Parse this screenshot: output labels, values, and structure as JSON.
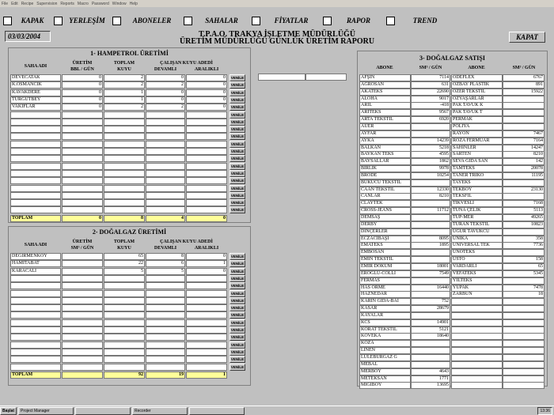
{
  "menu": [
    "File",
    "Edit",
    "Recipe",
    "Supervision",
    "Reports",
    "Macro",
    "Password",
    "Window",
    "Help"
  ],
  "nav": [
    "KAPAK",
    "YERLEŞİM",
    "ABONELER",
    "SAHALAR",
    "FİYATLAR",
    "RAPOR",
    "TREND"
  ],
  "date": "03/03/2004",
  "title1": "T.P.A.O. TRAKYA İŞLETME MÜDÜRLÜĞÜ",
  "title2": "ÜRETİM MÜDÜRLÜĞÜ GÜNLÜK ÜRETİM RAPORU",
  "close": "KAPAT",
  "p1": {
    "title": "1- HAMPETROL ÜRETİMİ",
    "h_saha": "SAHA ADI",
    "h_uretim": "ÜRETİM",
    "h_uretim_unit": "BBL / GÜN",
    "h_toplam": "TOPLAM",
    "h_kuyu": "KUYU",
    "h_calisan": "ÇALIŞAN KUYU ADEDİ",
    "h_devamli": "DEVAMLI",
    "h_aralikli": "ARALIKLI",
    "rows": [
      [
        "DEVECATAK",
        "0",
        "2",
        "0",
        "0"
      ],
      [
        "K.OSMANCIK",
        "0",
        "2",
        "2",
        "0"
      ],
      [
        "KAVAKDERE",
        "0",
        "1",
        "0",
        "0"
      ],
      [
        "TURGUTBEY",
        "0",
        "1",
        "0",
        "0"
      ],
      [
        "VAKIFLAR",
        "0",
        "2",
        "2",
        "0"
      ]
    ],
    "total": [
      "TOPLAM",
      "0",
      "8",
      "4",
      "0"
    ]
  },
  "p2": {
    "title": "2- DOĞALGAZ ÜRETİMİ",
    "h_saha": "SAHA ADI",
    "h_uretim": "ÜRETİM",
    "h_uretim_unit": "SM³ / GÜN",
    "h_toplam": "TOPLAM",
    "h_kuyu": "KUYU",
    "h_calisan": "ÇALIŞAN KUYU ADEDİ",
    "h_devamli": "DEVAMLI",
    "h_aralikli": "ARALIKLI",
    "rows": [
      [
        "DEĞİRMENKÖY",
        "",
        "65",
        "8",
        "0"
      ],
      [
        "HAMİTABAT",
        "",
        "22",
        "6",
        "1"
      ],
      [
        "KARACALİ",
        "",
        "5",
        "5",
        "0"
      ]
    ],
    "total": [
      "TOPLAM",
      "",
      "92",
      "19",
      "1"
    ]
  },
  "venile": "VENİLE",
  "p3": {
    "title": "3- DOĞALGAZ SATIŞI",
    "h_abone": "ABONE",
    "h_sm3": "SM³ / GÜN",
    "left": [
      [
        "AFŞİN",
        "7114"
      ],
      [
        "AGROSAN",
        "631"
      ],
      [
        "AKATEKS",
        "22690"
      ],
      [
        "ALOHA",
        "9017"
      ],
      [
        "ARİL",
        "-418"
      ],
      [
        "ARITEKS",
        "9567"
      ],
      [
        "ARTA TEKSTİL",
        "6920"
      ],
      [
        "AUER",
        ""
      ],
      [
        "AYFAR",
        ""
      ],
      [
        "AYKA",
        "14239"
      ],
      [
        "BALKAN",
        "5218"
      ],
      [
        "BAYKAN TEKS",
        "4595"
      ],
      [
        "BAYSALLAR",
        "1862"
      ],
      [
        "BİRLİK",
        "9978"
      ],
      [
        "BRODE",
        "10254"
      ],
      [
        "BÜKÜCÜ TEKSTİL",
        ""
      ],
      [
        "CAAN TEKSTİL",
        "12330"
      ],
      [
        "CANLAR",
        "8210"
      ],
      [
        "CLAYTEK",
        ""
      ],
      [
        "CROSS-JEANS",
        "11712"
      ],
      [
        "DEMSAŞ",
        ""
      ],
      [
        "DERBY",
        ""
      ],
      [
        "DİNÇERLER",
        ""
      ],
      [
        "ECZACIBAŞI",
        "8095"
      ],
      [
        "EMATEKS",
        "1895"
      ],
      [
        "EMBOSAN",
        ""
      ],
      [
        "EMİN TEKSTİL",
        ""
      ],
      [
        "EMİR DÖKÜM",
        "18001"
      ],
      [
        "EROĞLU-COLLI",
        "7549"
      ],
      [
        "FERMAS",
        ""
      ],
      [
        "HAS ÖRME",
        "16440"
      ],
      [
        "HAZNEDAR",
        ""
      ],
      [
        "KARİN GIDA-BAI",
        "752"
      ],
      [
        "KASAR",
        "28679"
      ],
      [
        "KAYALAR",
        ""
      ],
      [
        "KCS",
        "14901"
      ],
      [
        "KORAT TEKSTİL",
        "5121"
      ],
      [
        "KOVEKA",
        "18640"
      ],
      [
        "KOZA",
        ""
      ],
      [
        "LİNEN",
        ""
      ],
      [
        "LÜLEBURGAZ G",
        ""
      ],
      [
        "MEBAL",
        ""
      ],
      [
        "MERBOY",
        "4643"
      ],
      [
        "METEKSAN",
        "1771"
      ],
      [
        "MİGİBOY",
        "13695"
      ]
    ],
    "right": [
      [
        "ODEFLEX",
        "6767"
      ],
      [
        "ÖZBAY PLASTİK",
        "891"
      ],
      [
        "ÖZER TEKSTİL",
        "15922"
      ],
      [
        "ÖZYAŞARLAR",
        ""
      ],
      [
        "PAK TAVUK K",
        ""
      ],
      [
        "PAK TAVUK T",
        ""
      ],
      [
        "PERMAK",
        ""
      ],
      [
        "POLİYA",
        ""
      ],
      [
        "RAYON",
        "7467"
      ],
      [
        "ROZA FERMUAR",
        "7164"
      ],
      [
        "SAHİNLER",
        "14247"
      ],
      [
        "SARTEN",
        "8210"
      ],
      [
        "SEVA GIDA SAN",
        "142"
      ],
      [
        "TAMTEKS",
        "20078"
      ],
      [
        "TANER TRİKO",
        "11195"
      ],
      [
        "TAYEKS",
        ""
      ],
      [
        "TEKBOY",
        "23130"
      ],
      [
        "TEKSFİL",
        ""
      ],
      [
        "TİKVESLİ",
        "7168"
      ],
      [
        "TUNA ÇELİK",
        "5113"
      ],
      [
        "TÜP-MER",
        "49265"
      ],
      [
        "TURAN TEKSTİL",
        "10823"
      ],
      [
        "UGUR TAVUKCU",
        ""
      ],
      [
        "ÜNİKA",
        "358"
      ],
      [
        "UNİVERSAL TEK",
        "7736"
      ],
      [
        "UNOTEKS",
        ""
      ],
      [
        "USTO",
        "158"
      ],
      [
        "VARDARLI",
        "65"
      ],
      [
        "VEFATEKS",
        "5345"
      ],
      [
        "YILTEKS",
        ""
      ],
      [
        "YUPAK",
        "7478"
      ],
      [
        "ZARBUN",
        "18"
      ],
      [
        "",
        ""
      ],
      [
        "",
        ""
      ],
      [
        "",
        ""
      ],
      [
        "",
        ""
      ],
      [
        "",
        ""
      ],
      [
        "",
        ""
      ],
      [
        "",
        ""
      ],
      [
        "",
        ""
      ],
      [
        "",
        ""
      ],
      [
        "",
        ""
      ],
      [
        "",
        ""
      ],
      [
        "",
        ""
      ],
      [
        "",
        ""
      ]
    ]
  },
  "taskbar": {
    "start": "Başlat",
    "clock": "13:36",
    "tasks": [
      "Project Manager",
      "",
      "Recorder",
      ""
    ]
  }
}
